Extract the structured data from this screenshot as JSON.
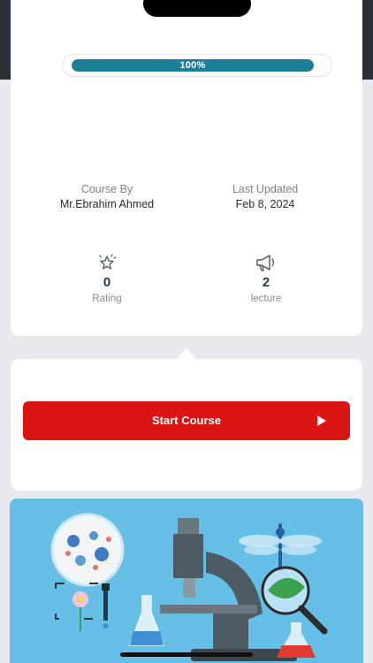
{
  "progress": {
    "label": "100%",
    "value": 1.0
  },
  "course": {
    "by_label": "Course By",
    "by_value": "Mr.Ebrahim Ahmed",
    "updated_label": "Last Updated",
    "updated_value": "Feb 8, 2024"
  },
  "stats": {
    "rating": {
      "icon": "stars-icon",
      "value": "0",
      "label": "Rating"
    },
    "lecture": {
      "icon": "megaphone-icon",
      "value": "2",
      "label": "lecture"
    }
  },
  "actions": {
    "start_label": "Start Course",
    "start_icon": "play-icon"
  },
  "banner": {
    "subject": "biology-illustration"
  },
  "colors": {
    "accent": "#1c7f98",
    "button": "#db1414",
    "background": "#e8e8ef",
    "banner": "#66bfe6"
  }
}
